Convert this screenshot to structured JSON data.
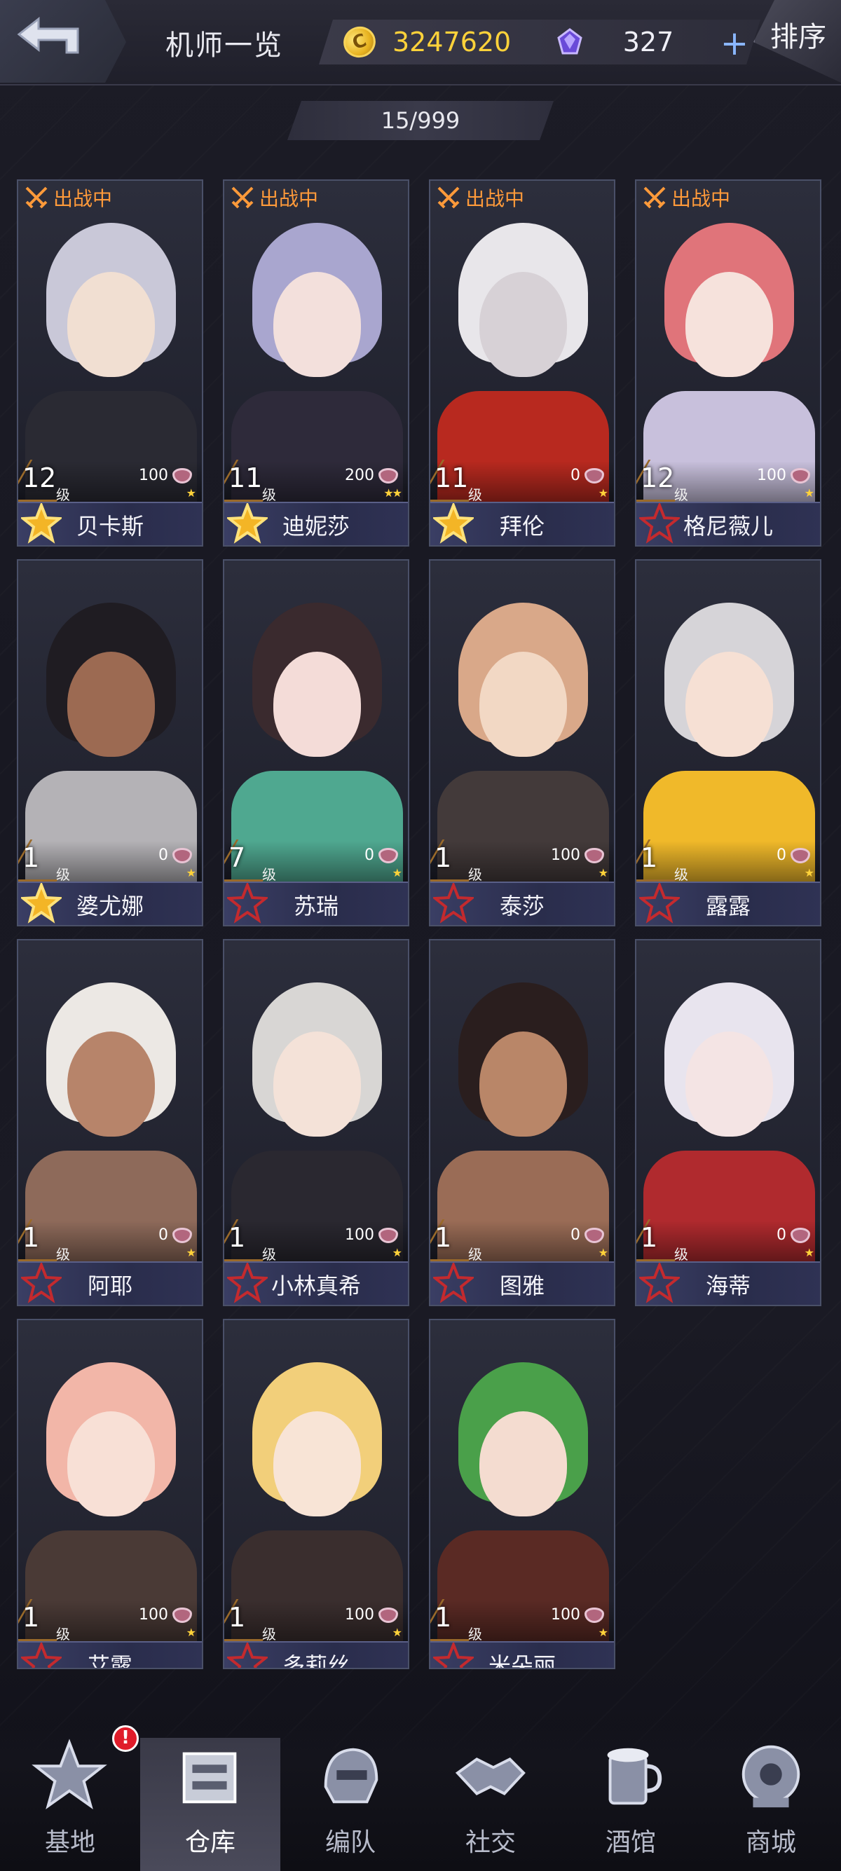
{
  "header": {
    "title": "机师一览",
    "coins": "3247620",
    "gems": "327",
    "plus_label": "+",
    "sort_label": "排序"
  },
  "roster_count": "15/999",
  "icons": {
    "back": "back-arrow-icon",
    "coin": "coin-icon",
    "gem": "gem-icon",
    "status": "crossed-swords-icon",
    "stat": "heart-stat-icon",
    "rank": "star-rank-icon"
  },
  "colors": {
    "accent_gold": "#ffd23a",
    "status_orange": "#ff9a3a",
    "badge_red": "#e01c2a",
    "name_bar": "#3a3e64"
  },
  "pilots": [
    {
      "name": "贝卡斯",
      "level": "12",
      "level_unit": "级",
      "stat": "100",
      "stars": "★",
      "status": "出战中",
      "rank_filled": true,
      "palette": [
        "#c9c8d8",
        "#2a2a33",
        "#f1dfd2"
      ]
    },
    {
      "name": "迪妮莎",
      "level": "11",
      "level_unit": "级",
      "stat": "200",
      "stars": "★★",
      "status": "出战中",
      "rank_filled": true,
      "palette": [
        "#a9a6cf",
        "#2e2a3a",
        "#f3e0dc"
      ]
    },
    {
      "name": "拜伦",
      "level": "11",
      "level_unit": "级",
      "stat": "0",
      "stars": "★",
      "status": "出战中",
      "rank_filled": true,
      "palette": [
        "#e8e6ea",
        "#b8291f",
        "#d7d1d6"
      ]
    },
    {
      "name": "格尼薇儿",
      "level": "12",
      "level_unit": "级",
      "stat": "100",
      "stars": "★",
      "status": "出战中",
      "rank_filled": false,
      "palette": [
        "#e0747a",
        "#c8c0dc",
        "#f6e2dc"
      ]
    },
    {
      "name": "婆尤娜",
      "level": "1",
      "level_unit": "级",
      "stat": "0",
      "stars": "★",
      "status": "",
      "rank_filled": true,
      "palette": [
        "#1f1c22",
        "#b4b2b6",
        "#9c6a52"
      ]
    },
    {
      "name": "苏瑞",
      "level": "7",
      "level_unit": "级",
      "stat": "0",
      "stars": "★",
      "status": "",
      "rank_filled": false,
      "palette": [
        "#3a2a2e",
        "#4fa890",
        "#f4dcd8"
      ]
    },
    {
      "name": "泰莎",
      "level": "1",
      "level_unit": "级",
      "stat": "100",
      "stars": "★",
      "status": "",
      "rank_filled": false,
      "palette": [
        "#d9a889",
        "#433a3a",
        "#f2d8c4"
      ]
    },
    {
      "name": "露露",
      "level": "1",
      "level_unit": "级",
      "stat": "0",
      "stars": "★",
      "status": "",
      "rank_filled": false,
      "palette": [
        "#d6d4d8",
        "#f0b92a",
        "#f6e0d4"
      ]
    },
    {
      "name": "阿耶",
      "level": "1",
      "level_unit": "级",
      "stat": "0",
      "stars": "★",
      "status": "",
      "rank_filled": false,
      "palette": [
        "#ece8e4",
        "#8e6a5a",
        "#b7846a"
      ]
    },
    {
      "name": "小林真希",
      "level": "1",
      "level_unit": "级",
      "stat": "100",
      "stars": "★",
      "status": "",
      "rank_filled": false,
      "palette": [
        "#d8d6d4",
        "#2a2830",
        "#f4e2d8"
      ]
    },
    {
      "name": "图雅",
      "level": "1",
      "level_unit": "级",
      "stat": "0",
      "stars": "★",
      "status": "",
      "rank_filled": false,
      "palette": [
        "#2a1e1e",
        "#9a6c56",
        "#b98668"
      ]
    },
    {
      "name": "海蒂",
      "level": "1",
      "level_unit": "级",
      "stat": "0",
      "stars": "★",
      "status": "",
      "rank_filled": false,
      "palette": [
        "#e8e4ee",
        "#b02a2e",
        "#f4e4e4"
      ]
    },
    {
      "name": "艾露",
      "level": "1",
      "level_unit": "级",
      "stat": "100",
      "stars": "★",
      "status": "",
      "rank_filled": false,
      "palette": [
        "#f2b6a8",
        "#4a3a36",
        "#f8e0d6"
      ]
    },
    {
      "name": "多莉丝",
      "level": "1",
      "level_unit": "级",
      "stat": "100",
      "stars": "★",
      "status": "",
      "rank_filled": false,
      "palette": [
        "#f2cf7a",
        "#3a2e2e",
        "#f8e4d6"
      ]
    },
    {
      "name": "米朵丽",
      "level": "1",
      "level_unit": "级",
      "stat": "100",
      "stars": "★",
      "status": "",
      "rank_filled": false,
      "palette": [
        "#4aa04a",
        "#5a2a24",
        "#f4dcd0"
      ]
    }
  ],
  "nav": [
    {
      "label": "基地",
      "icon": "base-emblem-icon",
      "active": false,
      "badge": "!"
    },
    {
      "label": "仓库",
      "icon": "warehouse-box-icon",
      "active": true,
      "badge": ""
    },
    {
      "label": "编队",
      "icon": "mech-helmet-icon",
      "active": false,
      "badge": ""
    },
    {
      "label": "社交",
      "icon": "handshake-icon",
      "active": false,
      "badge": ""
    },
    {
      "label": "酒馆",
      "icon": "beer-mug-icon",
      "active": false,
      "badge": ""
    },
    {
      "label": "商城",
      "icon": "robot-orb-icon",
      "active": false,
      "badge": ""
    }
  ]
}
